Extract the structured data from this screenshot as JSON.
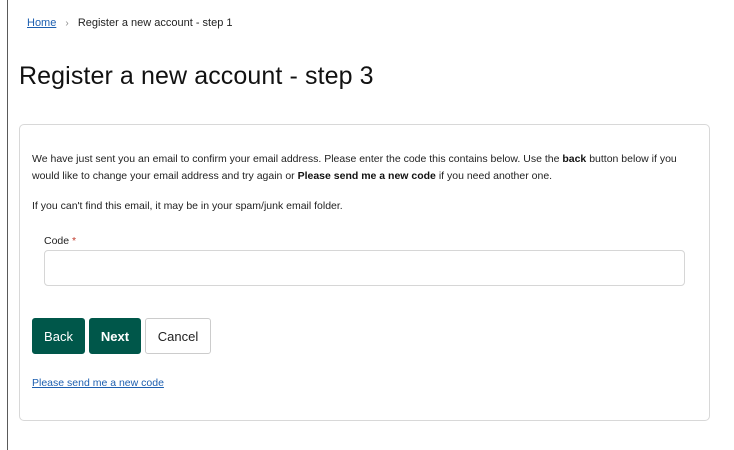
{
  "breadcrumb": {
    "home": "Home",
    "separator": "›",
    "current": "Register a new account - step 1"
  },
  "page": {
    "title": "Register a new account - step 3"
  },
  "instructions": {
    "p1_part1": "We have just sent you an email to confirm your email address. Please enter the code this contains below. Use the ",
    "p1_bold1": "back",
    "p1_part2": " button below if you would like to change your email address and try again or ",
    "p1_bold2": "Please send me a new code",
    "p1_part3": " if you need another one.",
    "p2": "If you can't find this email, it may be in your spam/junk email folder."
  },
  "form": {
    "code_label": "Code",
    "required_marker": "*",
    "code_value": ""
  },
  "buttons": {
    "back": "Back",
    "next": "Next",
    "cancel": "Cancel"
  },
  "links": {
    "resend": "Please send me a new code"
  },
  "colors": {
    "primary_button": "#00574a",
    "link": "#1d5fb0",
    "required": "#c0392b"
  }
}
